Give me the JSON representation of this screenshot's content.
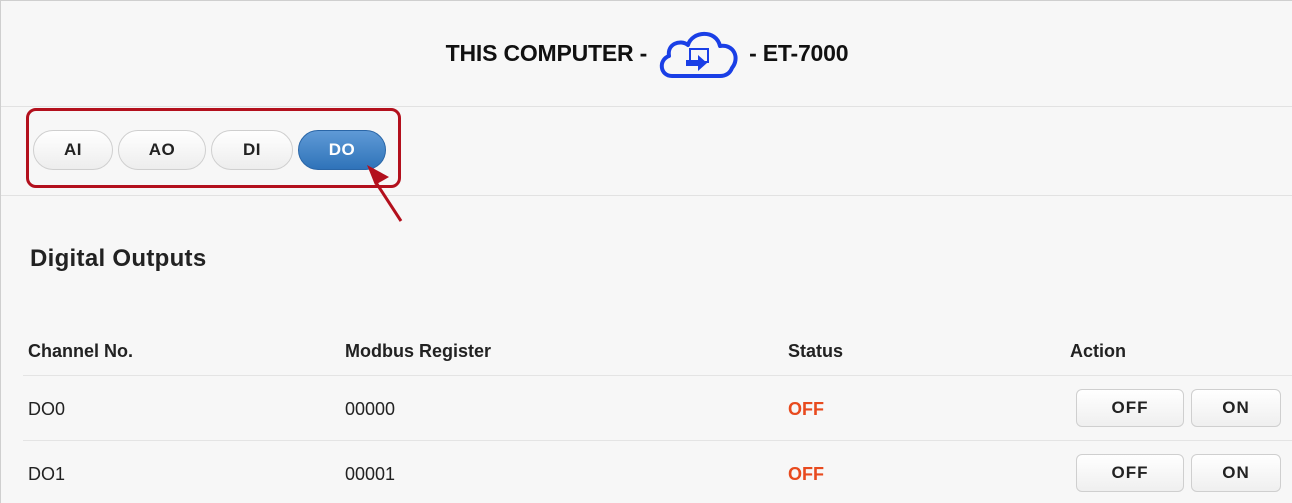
{
  "header": {
    "left_text": "THIS COMPUTER -",
    "right_text": "- ET-7000",
    "cloud_icon": "cloud-transfer-icon",
    "colors": {
      "cloud": "#1a3fe6"
    }
  },
  "tabs": [
    {
      "label": "AI",
      "active": false
    },
    {
      "label": "AO",
      "active": false
    },
    {
      "label": "DI",
      "active": false
    },
    {
      "label": "DO",
      "active": true
    }
  ],
  "section": {
    "title": "Digital Outputs"
  },
  "table": {
    "columns": [
      "Channel No.",
      "Modbus Register",
      "Status",
      "Action"
    ],
    "rows": [
      {
        "channel": "DO0",
        "register": "00000",
        "status": "OFF",
        "off_label": "OFF",
        "on_label": "ON"
      },
      {
        "channel": "DO1",
        "register": "00001",
        "status": "OFF",
        "off_label": "OFF",
        "on_label": "ON"
      }
    ]
  },
  "colors": {
    "accent": "#2f73b9",
    "status_off": "#e84a1e",
    "annotation": "#b3101d"
  }
}
